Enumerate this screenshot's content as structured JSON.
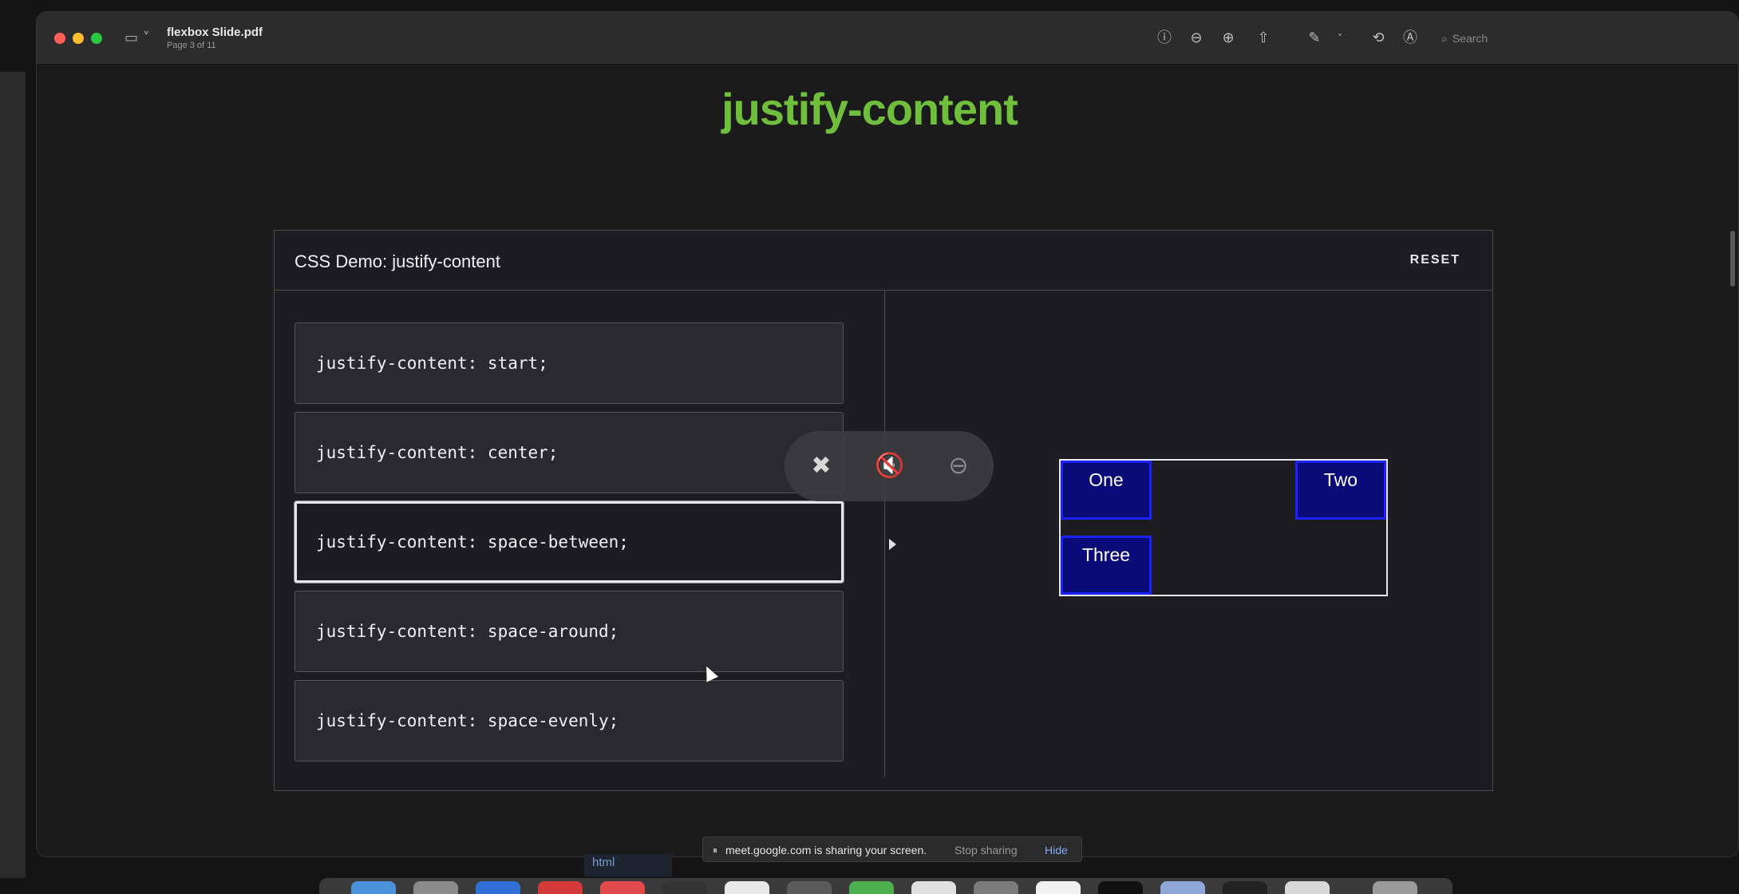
{
  "window": {
    "doc_title": "flexbox Slide.pdf",
    "doc_subtitle": "Page 3 of 11",
    "search_placeholder": "Search"
  },
  "slide": {
    "title": "justify-content"
  },
  "demo": {
    "title": "CSS Demo: justify-content",
    "reset_label": "RESET",
    "options": [
      {
        "label": "justify-content: start;"
      },
      {
        "label": "justify-content: center;"
      },
      {
        "label": "justify-content: space-between;",
        "selected": true
      },
      {
        "label": "justify-content: space-around;"
      },
      {
        "label": "justify-content: space-evenly;"
      }
    ],
    "output_items": [
      {
        "label": "One"
      },
      {
        "label": "Two"
      },
      {
        "label": "Three"
      }
    ]
  },
  "meet_controls": {
    "icons": [
      "unpin-icon",
      "mute-icon",
      "remove-icon"
    ]
  },
  "share_bar": {
    "pause_icon": "pause-icon",
    "message": "meet.google.com is sharing your screen.",
    "stop_label": "Stop sharing",
    "hide_label": "Hide"
  },
  "background_tab": {
    "label": "html"
  },
  "colors": {
    "slide_title": "#6fbf3c",
    "item_fill": "#0a0a78",
    "item_border": "#1a22ff",
    "hide_link": "#7ea7f5"
  }
}
